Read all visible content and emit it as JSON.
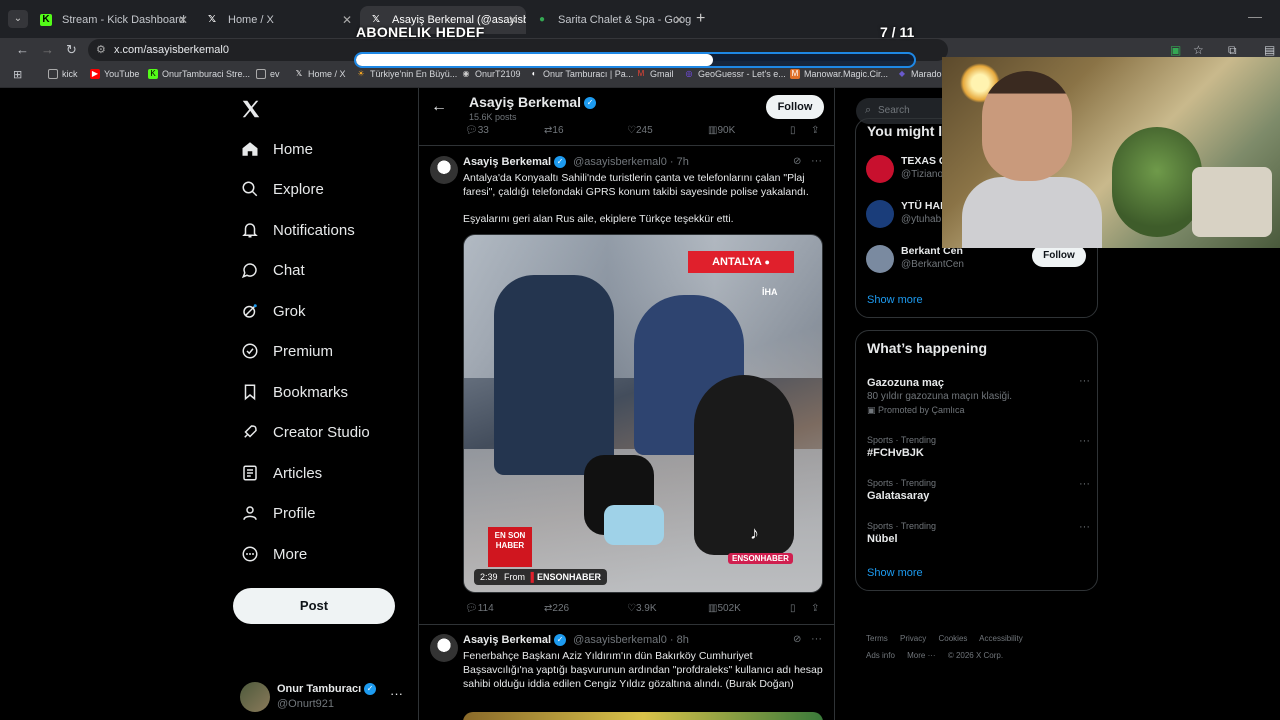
{
  "browser": {
    "tabs": [
      {
        "label": "Stream - Kick Dashboard",
        "favicon": "kick-icon"
      },
      {
        "label": "Home / X",
        "favicon": "x-icon"
      },
      {
        "label": "Asayiş Berkemal (@asayisberke",
        "favicon": "x-icon"
      },
      {
        "label": "Sarita Chalet & Spa - Google H",
        "favicon": "maps-icon"
      }
    ],
    "url": "x.com/asayisberkemal0",
    "bookmarks": [
      "kick",
      "YouTube",
      "OnurTamburaci Stre...",
      "ev",
      "Home / X",
      "Türkiye'nin En Büyü...",
      "OnurT2109",
      "Onur Tamburacı | Pa...",
      "Gmail",
      "GeoGuessr - Let's e...",
      "Manowar.Magic.Cir...",
      "Maradon"
    ]
  },
  "overlay": {
    "goal_title": "ABONELIK HEDEF",
    "goal_count": "7 / 11",
    "goal_progress": 0.64
  },
  "nav": {
    "items": [
      "Home",
      "Explore",
      "Notifications",
      "Chat",
      "Grok",
      "Premium",
      "Bookmarks",
      "Creator Studio",
      "Articles",
      "Profile",
      "More"
    ],
    "post_label": "Post",
    "account_name": "Onur Tamburacı",
    "account_handle": "@Onurt921"
  },
  "profile_header": {
    "name": "Asayiş Berkemal",
    "posts": "15.6K posts",
    "follow_label": "Follow"
  },
  "prev_tweet_actions": {
    "replies": "33",
    "reposts": "16",
    "likes": "245",
    "views": "90K"
  },
  "tweet1": {
    "name": "Asayiş Berkemal",
    "handle": "@asayisberkemal0 · 7h",
    "text1": "Antalya'da Konyaaltı Sahili'nde turistlerin çanta ve telefonlarını çalan \"Plaj faresi\", çaldığı telefondaki GPRS konum takibi sayesinde polise yakalandı.",
    "text2": "Eşyalarını geri alan Rus aile, ekiplere Türkçe teşekkür etti.",
    "media": {
      "location_tag": "ANTALYA",
      "agency": "İHA",
      "logo": "EN SON HABER",
      "watermark": "ENSONHABER",
      "duration": "2:39",
      "from": "From",
      "source": "ENSONHABER"
    },
    "replies": "114",
    "reposts": "226",
    "likes": "3.9K",
    "views": "502K"
  },
  "tweet2": {
    "name": "Asayiş Berkemal",
    "handle": "@asayisberkemal0 · 8h",
    "text": "Fenerbahçe Başkanı Aziz Yıldırım'ın dün Bakırköy Cumhuriyet Başsavcılığı'na yaptığı başvurunun ardından \"profdraleks\" kullanıcı adı hesap sahibi olduğu iddia edilen Cengiz Yıldız gözaltına alındı. (Burak Doğan)"
  },
  "search": {
    "placeholder": "Search"
  },
  "who_to_follow": {
    "title": "You might like",
    "accounts": [
      {
        "name": "TEXAS G",
        "handle": "@Tiziano",
        "avatar_color": "#c8102e"
      },
      {
        "name": "YTÜ HAB",
        "handle": "@ytuhab",
        "avatar_color": "#1a3d7a"
      },
      {
        "name": "Berkant Cen",
        "handle": "@BerkantCen",
        "avatar_color": "#7a8aa0"
      }
    ],
    "follow_label": "Follow",
    "show_more": "Show more"
  },
  "whats_happening": {
    "title": "What’s happening",
    "trends": [
      {
        "context": "",
        "title": "Gazozuna maç",
        "sub": "80 yıldır gazozuna maçın klasiği.",
        "promo": "Promoted by Çamlıca"
      },
      {
        "context": "Sports · Trending",
        "title": "#FCHvBJK",
        "sub": "",
        "promo": ""
      },
      {
        "context": "Sports · Trending",
        "title": "Galatasaray",
        "sub": "",
        "promo": ""
      },
      {
        "context": "Sports · Trending",
        "title": "Nübel",
        "sub": "",
        "promo": ""
      }
    ],
    "show_more": "Show more"
  },
  "footer": {
    "links": [
      "Terms",
      "Privacy",
      "Cookies",
      "Accessibility",
      "Ads info",
      "More ···",
      "© 2026 X Corp."
    ]
  },
  "colors": {
    "accent": "#1d9bf0",
    "background": "#000000",
    "goal_bar_border": "#1e88e5"
  }
}
